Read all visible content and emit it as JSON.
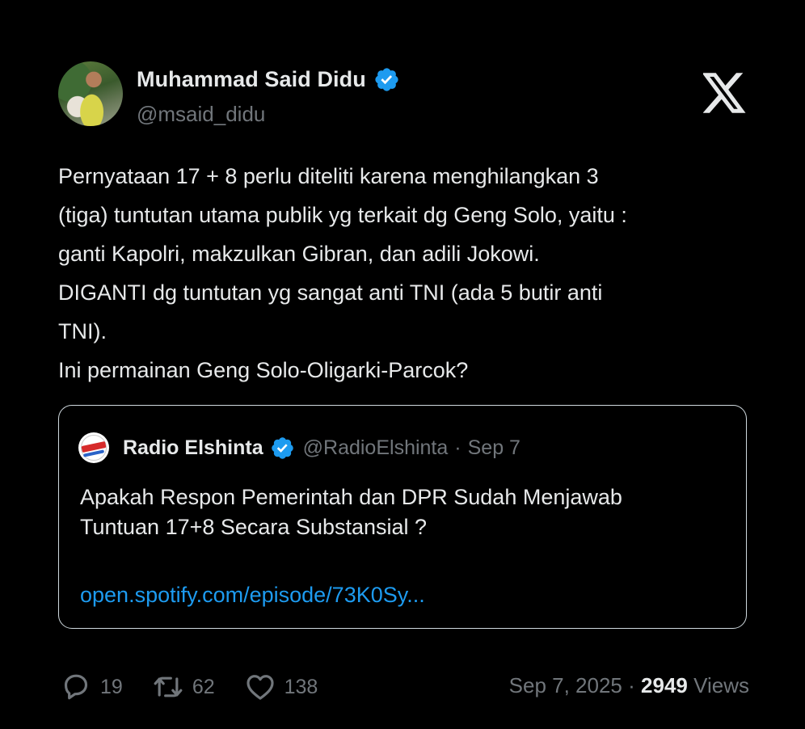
{
  "author": {
    "name": "Muhammad Said Didu",
    "handle": "@msaid_didu",
    "verified": true
  },
  "tweet": {
    "lines": [
      "Pernyataan 17 + 8 perlu diteliti karena menghilangkan 3",
      "(tiga) tuntutan utama publik yg terkait dg Geng Solo, yaitu :",
      "ganti Kapolri, makzulkan Gibran, dan adili Jokowi.",
      "DIGANTI dg tuntutan yg sangat anti TNI (ada 5 butir anti",
      "TNI).",
      "Ini permainan Geng Solo-Oligarki-Parcok?"
    ]
  },
  "quote": {
    "name": "Radio Elshinta",
    "handle": "@RadioElshinta",
    "separator": "·",
    "date": "Sep 7",
    "verified": true,
    "lines": [
      "Apakah Respon Pemerintah dan DPR Sudah Menjawab",
      "Tuntuan 17+8 Secara Substansial ?"
    ],
    "link": "open.spotify.com/episode/73K0Sy..."
  },
  "metrics": {
    "replies": "19",
    "retweets": "62",
    "likes": "138"
  },
  "footer": {
    "date": "Sep 7, 2025",
    "separator": "·",
    "views_count": "2949",
    "views_label": "Views"
  },
  "icons": {
    "verified": "verified-badge-icon",
    "brand": "x-logo-icon",
    "reply": "reply-icon",
    "retweet": "retweet-icon",
    "like": "heart-icon"
  },
  "colors": {
    "background": "#000000",
    "text": "#e7e9ea",
    "muted": "#71767b",
    "link": "#1d9bf0",
    "verified": "#1d9bf0",
    "quote_border": "#cfd9de"
  }
}
